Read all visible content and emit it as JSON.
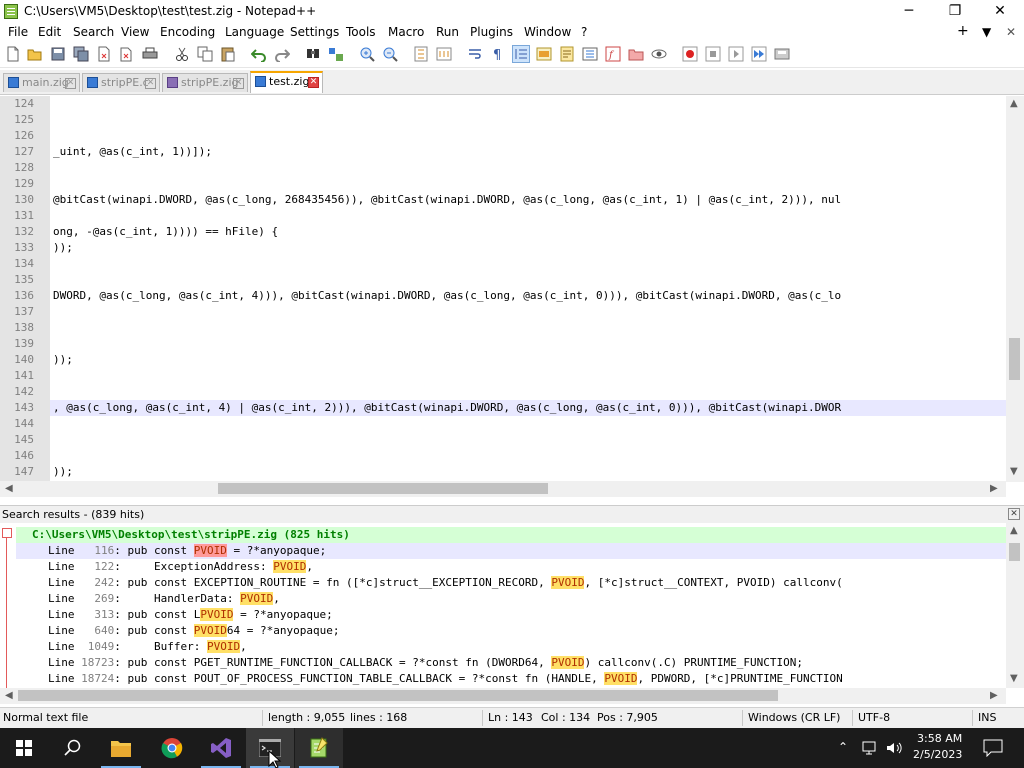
{
  "window": {
    "title": "C:\\Users\\VM5\\Desktop\\test\\test.zig - Notepad++",
    "minimize_glyph": "─",
    "restore_glyph": "❐",
    "close_glyph": "✕"
  },
  "menu": {
    "items": [
      "File",
      "Edit",
      "Search",
      "View",
      "Encoding",
      "Language",
      "Settings",
      "Tools",
      "Macro",
      "Run",
      "Plugins",
      "Window",
      "?"
    ],
    "right": [
      "+",
      "▼",
      "✕"
    ]
  },
  "tabs": [
    {
      "label": "main.zig",
      "active": false
    },
    {
      "label": "stripPE.c",
      "active": false
    },
    {
      "label": "stripPE.zig",
      "active": false
    },
    {
      "label": "test.zig",
      "active": true
    }
  ],
  "editor": {
    "lines": [
      {
        "n": "124",
        "text": ""
      },
      {
        "n": "125",
        "text": ""
      },
      {
        "n": "126",
        "text": ""
      },
      {
        "n": "127",
        "text": "_uint, @as(c_int, 1))]);"
      },
      {
        "n": "128",
        "text": ""
      },
      {
        "n": "129",
        "text": ""
      },
      {
        "n": "130",
        "text": "@bitCast(winapi.DWORD, @as(c_long, 268435456)), @bitCast(winapi.DWORD, @as(c_long, @as(c_int, 1) | @as(c_int, 2))), nul"
      },
      {
        "n": "131",
        "text": ""
      },
      {
        "n": "132",
        "text": "ong, -@as(c_int, 1)))) == hFile) {"
      },
      {
        "n": "133",
        "text": "));"
      },
      {
        "n": "134",
        "text": ""
      },
      {
        "n": "135",
        "text": ""
      },
      {
        "n": "136",
        "text": "DWORD, @as(c_long, @as(c_int, 4))), @bitCast(winapi.DWORD, @as(c_long, @as(c_int, 0))), @bitCast(winapi.DWORD, @as(c_lo"
      },
      {
        "n": "137",
        "text": ""
      },
      {
        "n": "138",
        "text": ""
      },
      {
        "n": "139",
        "text": ""
      },
      {
        "n": "140",
        "text": "));"
      },
      {
        "n": "141",
        "text": ""
      },
      {
        "n": "142",
        "text": ""
      },
      {
        "n": "143",
        "text": ", @as(c_long, @as(c_int, 4) | @as(c_int, 2))), @bitCast(winapi.DWORD, @as(c_long, @as(c_int, 0))), @bitCast(winapi.DWOR"
      },
      {
        "n": "144",
        "text": ""
      },
      {
        "n": "145",
        "text": ""
      },
      {
        "n": "146",
        "text": ""
      },
      {
        "n": "147",
        "text": "));"
      }
    ],
    "current_line": "143"
  },
  "search_results": {
    "title": "Search results - (839 hits)",
    "file_header": "C:\\Users\\VM5\\Desktop\\test\\stripPE.zig (825 hits)",
    "rows": [
      {
        "prefix": "Line ",
        "num": "  116",
        "pre": ": pub const ",
        "match": "PVOID",
        "post": " = ?*anyopaque;"
      },
      {
        "prefix": "Line ",
        "num": "  122",
        "pre": ":     ExceptionAddress: ",
        "match": "PVOID",
        "post": ","
      },
      {
        "prefix": "Line ",
        "num": "  242",
        "pre": ": pub const EXCEPTION_ROUTINE = fn ([*c]struct__EXCEPTION_RECORD, ",
        "match": "PVOID",
        "post": ", [*c]struct__CONTEXT, PVOID) callconv("
      },
      {
        "prefix": "Line ",
        "num": "  269",
        "pre": ":     HandlerData: ",
        "match": "PVOID",
        "post": ","
      },
      {
        "prefix": "Line ",
        "num": "  313",
        "pre": ": pub const L",
        "match": "PVOID",
        "post": " = ?*anyopaque;"
      },
      {
        "prefix": "Line ",
        "num": "  640",
        "pre": ": pub const ",
        "match": "PVOID",
        "post": "64 = ?*anyopaque;"
      },
      {
        "prefix": "Line ",
        "num": " 1049",
        "pre": ":     Buffer: ",
        "match": "PVOID",
        "post": ","
      },
      {
        "prefix": "Line ",
        "num": "18723",
        "pre": ": pub const PGET_RUNTIME_FUNCTION_CALLBACK = ?*const fn (DWORD64, ",
        "match": "PVOID",
        "post": ") callconv(.C) PRUNTIME_FUNCTION;"
      },
      {
        "prefix": "Line ",
        "num": "18724",
        "pre": ": pub const POUT_OF_PROCESS_FUNCTION_TABLE_CALLBACK = ?*const fn (HANDLE, ",
        "match": "PVOID",
        "post": ", PDWORD, [*c]PRUNTIME_FUNCTION"
      }
    ],
    "close_glyph": "✕"
  },
  "status": {
    "file_type": "Normal text file",
    "length": "length : 9,055",
    "lines": "lines : 168",
    "ln": "Ln : 143",
    "col": "Col : 134",
    "pos": "Pos : 7,905",
    "eol": "Windows (CR LF)",
    "encoding": "UTF-8",
    "mode": "INS"
  },
  "taskbar": {
    "time": "3:58 AM",
    "date": "2/5/2023"
  },
  "colors": {
    "accent_tab": "#f7a600",
    "match_bg": "#ffe066",
    "file_header_bg": "#d5ffd5",
    "selected_line": "#e8e8ff"
  }
}
